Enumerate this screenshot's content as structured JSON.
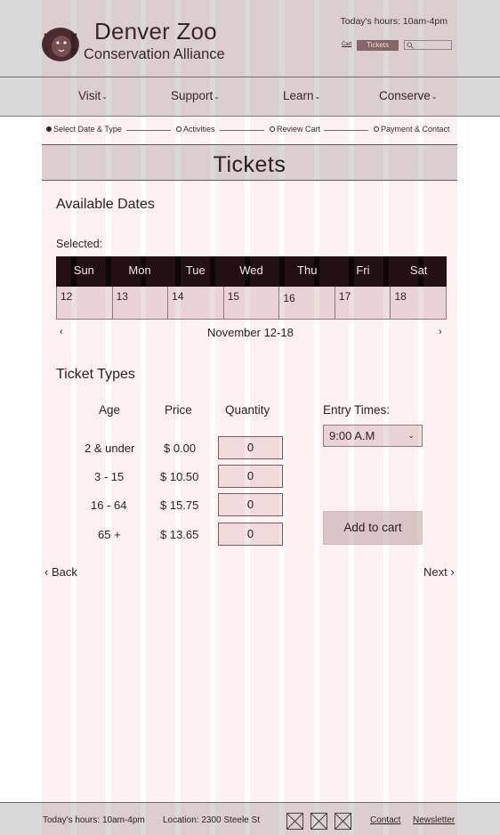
{
  "header": {
    "title": "Denver Zoo",
    "subtitle": "Conservation Alliance",
    "hours": "Today's hours: 10am-4pm",
    "cart_label": "Cart",
    "tickets_label": "Tickets",
    "search_placeholder": ""
  },
  "nav": {
    "items": [
      {
        "label": "Visit"
      },
      {
        "label": "Support"
      },
      {
        "label": "Learn"
      },
      {
        "label": "Conserve"
      }
    ]
  },
  "steps": [
    {
      "label": "Select Date & Type",
      "active": true
    },
    {
      "label": "Activities",
      "active": false
    },
    {
      "label": "Review Cart",
      "active": false
    },
    {
      "label": "Payment & Contact",
      "active": false
    }
  ],
  "page_title": "Tickets",
  "available_dates": {
    "title": "Available Dates",
    "selected_label": "Selected:",
    "days": [
      "Sun",
      "Mon",
      "Tue",
      "Wed",
      "Thu",
      "Fri",
      "Sat"
    ],
    "dates": [
      "12",
      "13",
      "14",
      "15",
      "16",
      "17",
      "18"
    ],
    "range_label": "November 12-18",
    "prev_label": "‹",
    "next_label": "›"
  },
  "ticket_types": {
    "title": "Ticket Types",
    "headers": {
      "age": "Age",
      "price": "Price",
      "quantity": "Quantity"
    },
    "rows": [
      {
        "age": "2 & under",
        "price": "$ 0.00",
        "qty": "0"
      },
      {
        "age": "3 - 15",
        "price": "$ 10.50",
        "qty": "0"
      },
      {
        "age": "16 - 64",
        "price": "$ 15.75",
        "qty": "0"
      },
      {
        "age": "65 +",
        "price": "$ 13.65",
        "qty": "0"
      }
    ],
    "entry_label": "Entry Times:",
    "entry_value": "9:00 A.M",
    "add_to_cart": "Add to cart"
  },
  "pager": {
    "back": "‹ Back",
    "next": "Next ›"
  },
  "footer": {
    "hours": "Today's hours: 10am-4pm",
    "location": "Location: 2300 Steele St",
    "contact": "Contact",
    "newsletter": "Newsletter"
  },
  "colors": {
    "header_bg": "#d9d9d9",
    "calendar_header": "#0d0507",
    "tickets_button": "#7a6467",
    "grid_overlay": "#f07878"
  }
}
